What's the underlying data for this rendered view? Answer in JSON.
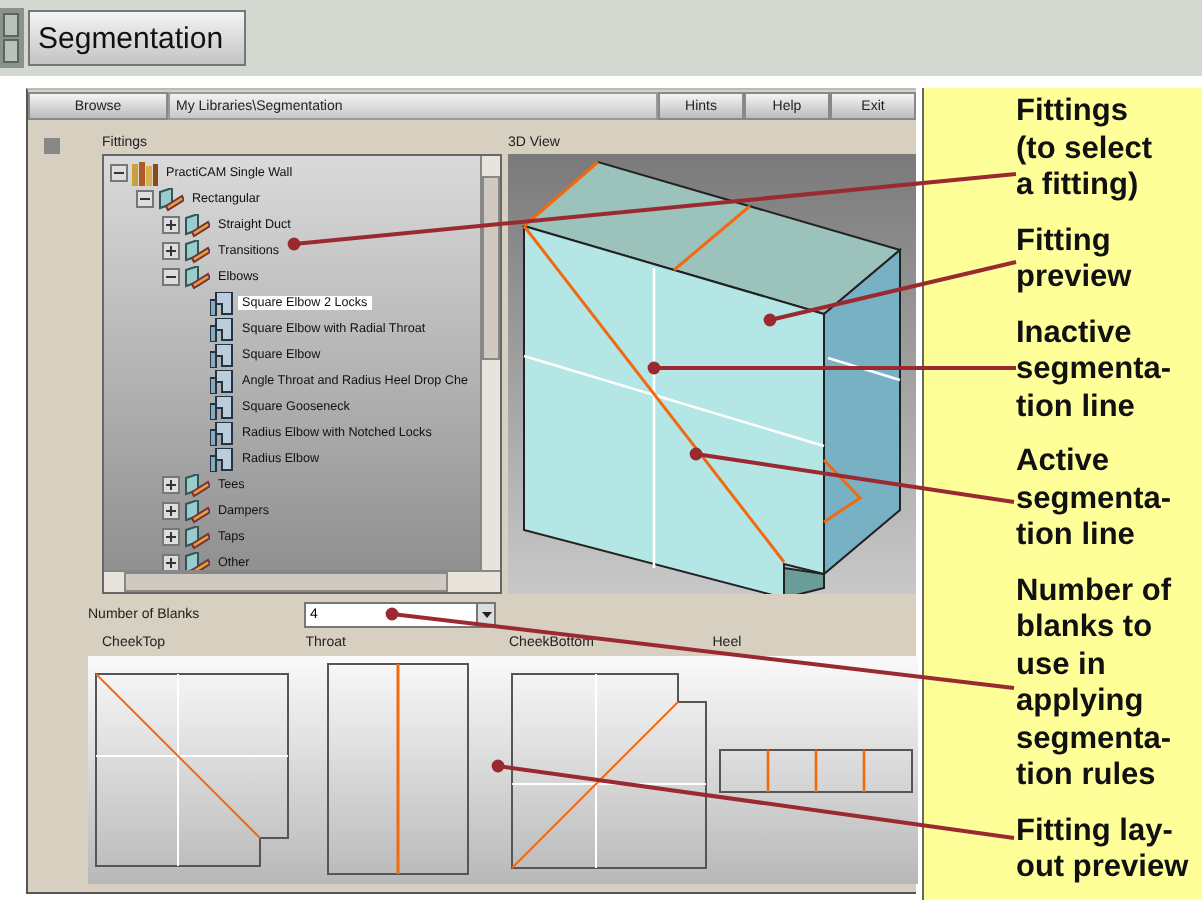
{
  "header": {
    "title": "Segmentation"
  },
  "toolbar": {
    "browse": "Browse",
    "path": "My Libraries\\Segmentation",
    "buttons": [
      "Hints",
      "Help",
      "Exit"
    ]
  },
  "fittings": {
    "label": "Fittings",
    "tree": [
      {
        "label": "PractiCAM Single Wall",
        "expanded": true,
        "children": [
          {
            "label": "Rectangular",
            "expanded": true,
            "children": [
              {
                "label": "Straight Duct",
                "expanded": false
              },
              {
                "label": "Transitions",
                "expanded": false
              },
              {
                "label": "Elbows",
                "expanded": true,
                "children": [
                  {
                    "label": "Square Elbow 2 Locks",
                    "selected": true
                  },
                  {
                    "label": "Square Elbow with Radial Throat",
                    "selected": false
                  },
                  {
                    "label": "Square Elbow",
                    "selected": false
                  },
                  {
                    "label": "Angle Throat and Radius Heel Drop Che",
                    "selected": false
                  },
                  {
                    "label": "Square Gooseneck",
                    "selected": false
                  },
                  {
                    "label": "Radius Elbow with Notched Locks",
                    "selected": false
                  },
                  {
                    "label": "Radius Elbow",
                    "selected": false
                  }
                ]
              },
              {
                "label": "Tees",
                "expanded": false
              },
              {
                "label": "Dampers",
                "expanded": false
              },
              {
                "label": "Taps",
                "expanded": false
              },
              {
                "label": "Other",
                "expanded": false
              }
            ]
          }
        ]
      }
    ]
  },
  "view3d": {
    "label": "3D View"
  },
  "blanks": {
    "label": "Number of Blanks",
    "value": "4"
  },
  "layout": {
    "pieces": [
      "CheekTop",
      "Throat",
      "CheekBottom",
      "Heel"
    ]
  },
  "callouts": [
    {
      "lines": [
        "Fittings",
        "(to select",
        "a fitting)"
      ]
    },
    {
      "lines": [
        "Fitting",
        "preview"
      ]
    },
    {
      "lines": [
        "Inactive",
        "segmenta-",
        "tion line"
      ]
    },
    {
      "lines": [
        "Active",
        "segmenta-",
        "tion line"
      ]
    },
    {
      "lines": [
        "Number of",
        "blanks to",
        "use in",
        "applying",
        "segmenta-",
        "tion rules"
      ]
    },
    {
      "lines": [
        "Fitting lay-",
        "out preview"
      ]
    }
  ]
}
